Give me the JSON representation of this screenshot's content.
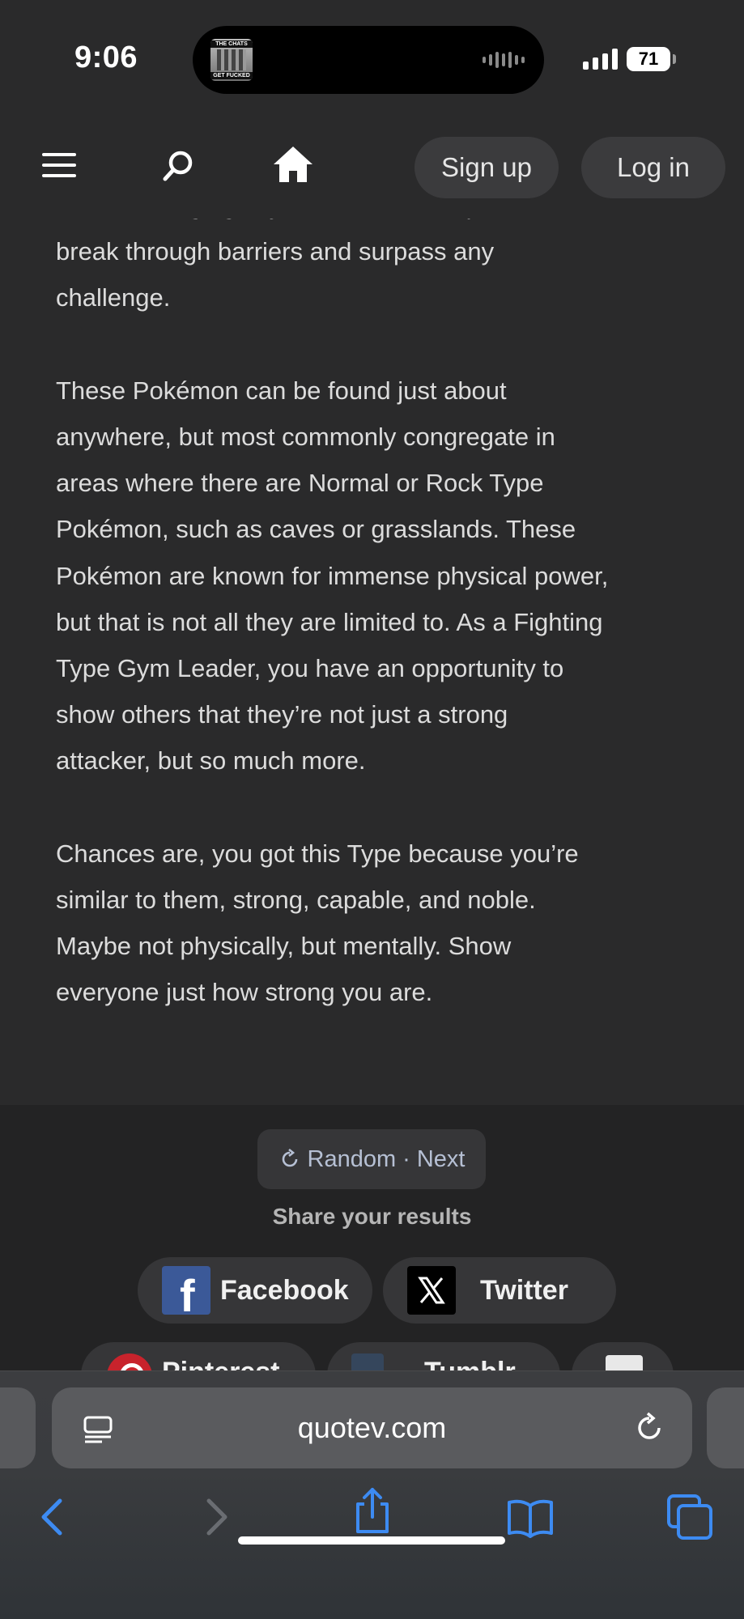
{
  "status_bar": {
    "time": "9:06",
    "battery": "71",
    "now_playing_art": {
      "top_text": "THE CHATS",
      "bottom_text": "GET FUCKED"
    }
  },
  "nav": {
    "menu_icon": "hamburger-menu-icon",
    "search_icon": "magnifier-icon",
    "home_icon": "house-icon",
    "signup_label": "Sign up",
    "login_label": "Log in"
  },
  "article": {
    "paragraphs": [
      "and the bringing of justice. It has the power to break through barriers and surpass any challenge.",
      "These Pokémon can be found just about anywhere, but most commonly congregate in areas where there are Normal or Rock Type Pokémon, such as caves or grasslands. These Pokémon are known for immense physical power, but that is not all they are limited to. As a Fighting Type Gym Leader, you have an opportunity to show others that they’re not just a strong attacker, but so much more.",
      "Chances are, you got this Type because you’re similar to them, strong, capable, and noble. Maybe not physically, but mentally. Show everyone just how strong you are."
    ],
    "lines": [
      "and the bringing of justice. It has the power to",
      "break through barriers and surpass any",
      "challenge.",
      "These Pokémon can be found just about",
      "anywhere, but most commonly congregate in",
      "areas where there are Normal or Rock Type",
      "Pokémon, such as caves or grasslands. These",
      "Pokémon are known for immense physical power,",
      "but that is not all they are limited to. As a Fighting",
      "Type Gym Leader, you have an opportunity to",
      "show others that they’re not just a strong",
      "attacker, but so much more.",
      "Chances are, you got this Type because you’re",
      "similar to them, strong, capable, and noble.",
      "Maybe not physically, but mentally. Show",
      "everyone just how strong you are."
    ]
  },
  "results": {
    "random_label": "Random",
    "separator": "·",
    "next_label": "Next",
    "share_title": "Share your results",
    "share_buttons": [
      {
        "label": "Facebook",
        "color": "#3b5998"
      },
      {
        "label": "Twitter",
        "color": "#000000"
      },
      {
        "label": "Pinterest",
        "color": "#c8232c"
      },
      {
        "label": "Tumblr",
        "color": "#35465c"
      }
    ]
  },
  "browser": {
    "url": "quotev.com",
    "accent_color": "#3d8bf2"
  }
}
